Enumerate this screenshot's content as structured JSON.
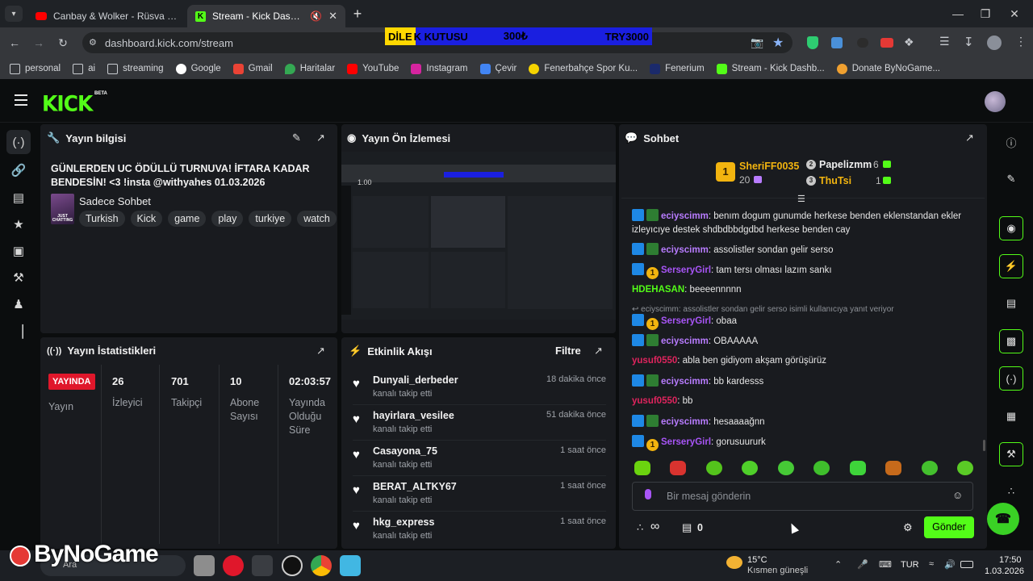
{
  "browser": {
    "tabs": [
      {
        "title": "Canbay & Wolker - Rüsva (Offic",
        "active": false
      },
      {
        "title": "Stream - Kick Dashboard",
        "active": true
      }
    ],
    "url": "dashboard.kick.com/stream",
    "bookmarks": [
      "personal",
      "ai",
      "streaming",
      "Google",
      "Gmail",
      "Haritalar",
      "YouTube",
      "Instagram",
      "Çevir",
      "Fenerbahçe Spor Ku...",
      "Fenerium",
      "Stream - Kick Dashb...",
      "Donate ByNoGame..."
    ]
  },
  "overlay": {
    "left": "DİLE",
    "label": "K KUTUSU",
    "amount": "300₺",
    "currency": "TRY3000"
  },
  "kick": {
    "logo": "KICK",
    "beta": "BETA"
  },
  "stream_info": {
    "title": "Yayın bilgisi",
    "stream_title": "GÜNLERDEN UC ÖDÜLLÜ TURNUVA! İFTARA KADAR BENDESİN! <3 !insta @withyahes 01.03.2026",
    "category": "Sadece Sohbet",
    "thumb_text": "JUST CHATTING",
    "tags": [
      "Turkish",
      "Kick",
      "game",
      "play",
      "turkiye",
      "watch"
    ]
  },
  "preview": {
    "title": "Yayın Ön İzlemesi",
    "time": "1.00"
  },
  "stats": {
    "title": "Yayın İstatistikleri",
    "live_badge": "YAYINDA",
    "live_label": "Yayın",
    "items": [
      {
        "value": "26",
        "label": "İzleyici"
      },
      {
        "value": "701",
        "label": "Takipçi"
      },
      {
        "value": "10",
        "label": "Abone Sayısı"
      },
      {
        "value": "02:03:57",
        "label": "Yayında Olduğu Süre"
      }
    ]
  },
  "activity": {
    "title": "Etkinlik Akışı",
    "filter": "Filtre",
    "events": [
      {
        "user": "Dunyali_derbeder",
        "action": "kanalı takip etti",
        "time": "18 dakika önce"
      },
      {
        "user": "hayirlara_vesilee",
        "action": "kanalı takip etti",
        "time": "51 dakika önce"
      },
      {
        "user": "Casayona_75",
        "action": "kanalı takip etti",
        "time": "1 saat önce"
      },
      {
        "user": "BERAT_ALTKY67",
        "action": "kanalı takip etti",
        "time": "1 saat önce"
      },
      {
        "user": "hkg_express",
        "action": "kanalı takip etti",
        "time": "1 saat önce"
      }
    ]
  },
  "chat": {
    "title": "Sohbet",
    "leaderboard": {
      "first": {
        "rank": "1",
        "name": "SheriFF0035",
        "count": "20"
      },
      "second": {
        "rank": "2",
        "name": "Papelizmm",
        "count": "6"
      },
      "third": {
        "rank": "3",
        "name": "ThuTsi",
        "count": "1"
      }
    },
    "messages": [
      {
        "user": "eciyscimm",
        "text": ": benım dogum gunumde herkese benden eklenstandan ekler izleyıcıye destek shdbdbbdgdbd herkese benden cay",
        "color": "#b87cff",
        "badges": "mod-sq"
      },
      {
        "user": "eciyscimm",
        "text": ": assolistler sondan gelir serso",
        "color": "#b87cff",
        "badges": "mod-sq"
      },
      {
        "user": "SerseryGirl",
        "text": ": tam tersı olması lazım sankı",
        "color": "#a855f7",
        "badges": "mod-gold"
      },
      {
        "user": "HDEHASAN",
        "text": ": beeeennnnn",
        "color": "#53fc18",
        "badges": ""
      },
      {
        "reply": "eciyscimm: assolistler sondan gelir serso isimli kullanıcıya yanıt veriyor"
      },
      {
        "user": "SerseryGirl",
        "text": ": obaa",
        "color": "#a855f7",
        "badges": "mod-gold"
      },
      {
        "user": "eciyscimm",
        "text": ": OBAAAAA",
        "color": "#b87cff",
        "badges": "mod-sq"
      },
      {
        "user": "yusuf0550",
        "text": ": abla ben gidiyom akşam görüşürüz",
        "color": "#e0245e",
        "badges": ""
      },
      {
        "user": "eciyscimm",
        "text": ": bb kardesss",
        "color": "#b87cff",
        "badges": "mod-sq"
      },
      {
        "user": "yusuf0550",
        "text": ": bb",
        "color": "#e0245e",
        "badges": ""
      },
      {
        "user": "eciyscimm",
        "text": ": hesaaaağnn",
        "color": "#b87cff",
        "badges": "mod-sq"
      },
      {
        "user": "SerseryGirl",
        "text": ": gorusuururk",
        "color": "#a855f7",
        "badges": "mod-gold"
      }
    ],
    "input_placeholder": "Bir mesaj gönderin",
    "points": "∞",
    "gift_count": "0",
    "send_label": "Gönder"
  },
  "taskbar": {
    "search": "Ara",
    "weather_temp": "15°C",
    "weather_desc": "Kısmen güneşli",
    "lang": "TUR",
    "time": "17:50",
    "date": "1.03.2026"
  },
  "watermark": "ByNoGame",
  "colors": {
    "accent": "#53fc18",
    "live": "#e0172b",
    "panel": "#191b1f"
  }
}
